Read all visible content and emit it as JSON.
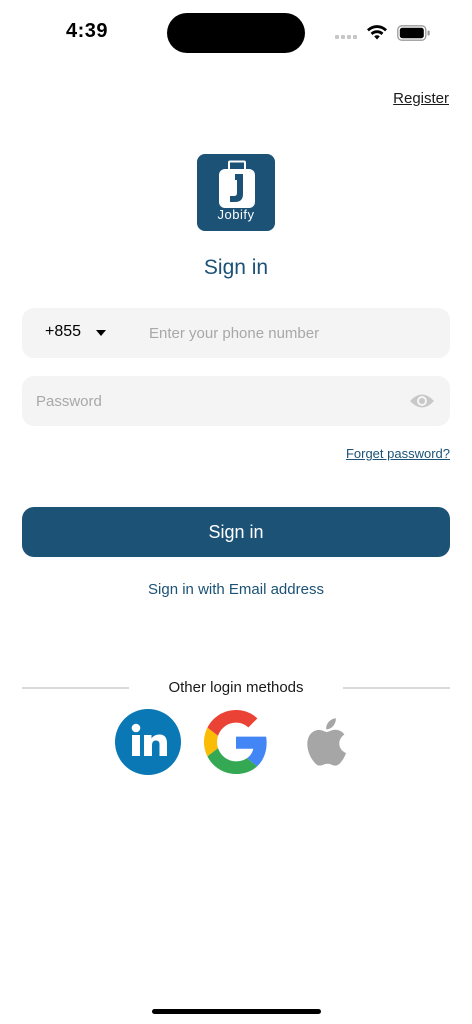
{
  "status_bar": {
    "time": "4:39"
  },
  "header": {
    "register_label": "Register"
  },
  "logo": {
    "text": "Jobify",
    "color": "#1b5276"
  },
  "title": "Sign in",
  "phone": {
    "country_code": "+855",
    "placeholder": "Enter your phone number",
    "value": ""
  },
  "password": {
    "placeholder": "Password",
    "value": ""
  },
  "forget_password_label": "Forget password?",
  "sign_in_button_label": "Sign in",
  "email_signin_label": "Sign in with Email address",
  "other_login": {
    "label": "Other login methods",
    "methods": [
      {
        "name": "LinkedIn",
        "icon": "linkedin-icon"
      },
      {
        "name": "Google",
        "icon": "google-icon"
      },
      {
        "name": "Apple",
        "icon": "apple-icon"
      }
    ]
  },
  "colors": {
    "primary": "#1b5276",
    "field_bg": "#f4f4f4",
    "placeholder": "#a8a8a8"
  }
}
